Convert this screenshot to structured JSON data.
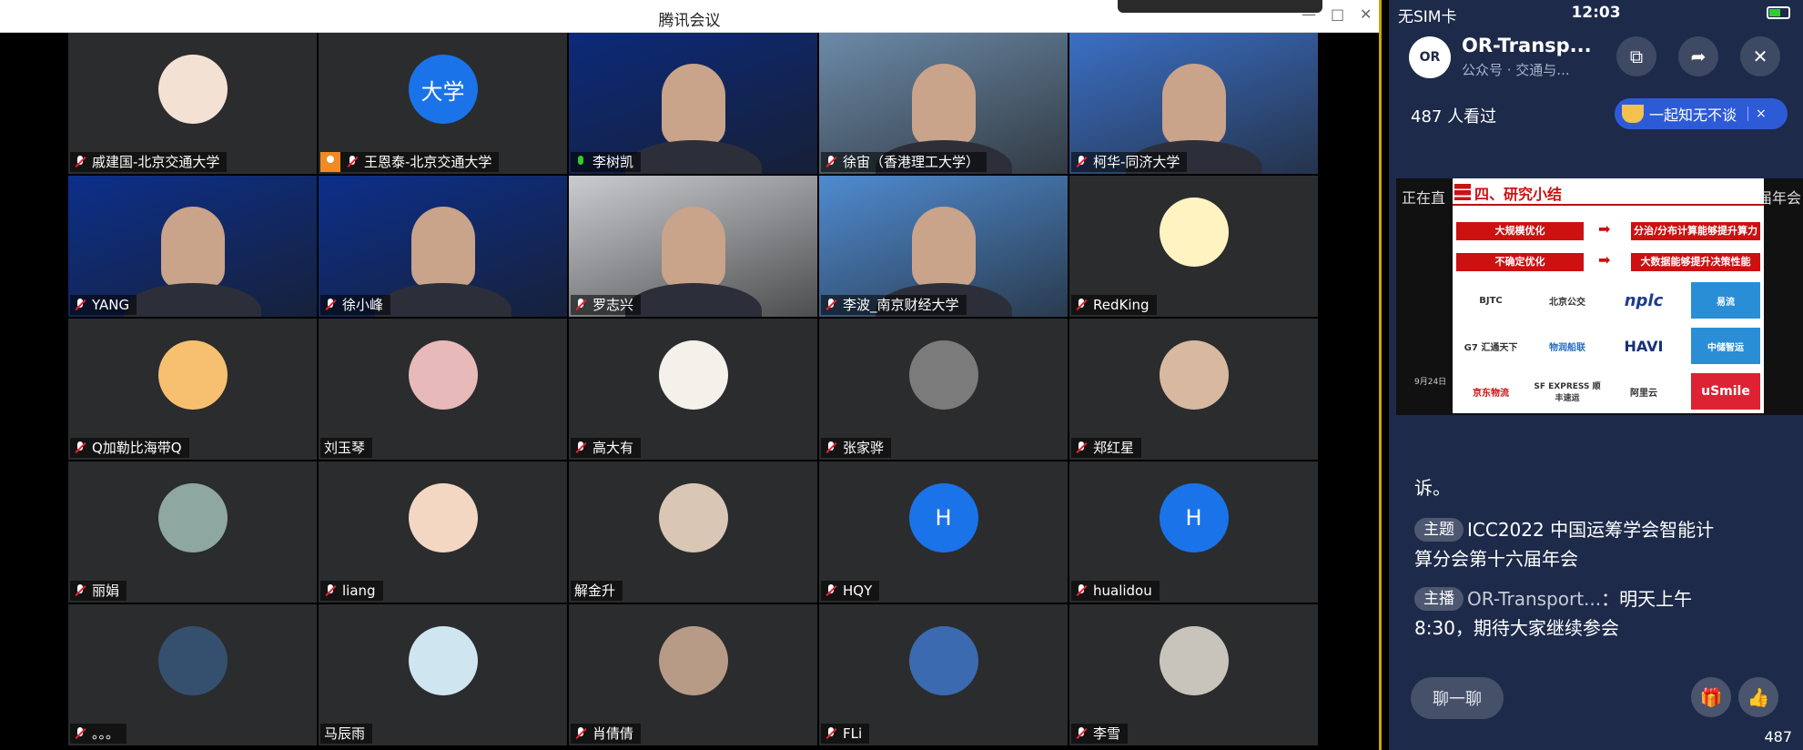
{
  "meeting": {
    "title": "腾讯会议",
    "participants": [
      {
        "name": "戚建国-北京交通大学",
        "kind": "avatar",
        "avatar_color": "#f3e2d4",
        "avatar_text": "",
        "mic": "muted"
      },
      {
        "name": "王恩泰-北京交通大学",
        "kind": "avatar",
        "avatar_color": "#1a73e8",
        "avatar_text": "大学",
        "mic": "muted",
        "host": true
      },
      {
        "name": "李树凯",
        "kind": "video",
        "bg": "#0c2a7a",
        "mic": "on",
        "talking": true
      },
      {
        "name": "徐宙（香港理工大学）",
        "kind": "video",
        "bg": "#6b8aa8",
        "mic": "muted"
      },
      {
        "name": "柯华-同济大学",
        "kind": "video",
        "bg": "#3b6fc4",
        "mic": "muted"
      },
      {
        "name": "YANG",
        "kind": "video",
        "bg": "#0c2f8a",
        "mic": "muted"
      },
      {
        "name": "徐小峰",
        "kind": "video",
        "bg": "#0c2f8a",
        "mic": "muted"
      },
      {
        "name": "罗志兴",
        "kind": "video",
        "bg": "#c9ccd0",
        "mic": "muted"
      },
      {
        "name": "李波_南京财经大学",
        "kind": "video",
        "bg": "#4f8bd0",
        "mic": "muted"
      },
      {
        "name": "RedKing",
        "kind": "avatar",
        "avatar_color": "#fff3c2",
        "avatar_text": "",
        "mic": "muted"
      },
      {
        "name": "Q加勒比海带Q",
        "kind": "avatar",
        "avatar_color": "#f6c070",
        "avatar_text": "",
        "mic": "muted"
      },
      {
        "name": "刘玉琴",
        "kind": "avatar",
        "avatar_color": "#e8b9b9",
        "avatar_text": "",
        "mic": "none"
      },
      {
        "name": "高大有",
        "kind": "avatar",
        "avatar_color": "#f4f1ea",
        "avatar_text": "",
        "mic": "muted"
      },
      {
        "name": "张家骅",
        "kind": "avatar",
        "avatar_color": "#7b7b7b",
        "avatar_text": "",
        "mic": "muted"
      },
      {
        "name": "郑红星",
        "kind": "avatar",
        "avatar_color": "#d8b9a0",
        "avatar_text": "",
        "mic": "muted"
      },
      {
        "name": "丽娟",
        "kind": "avatar",
        "avatar_color": "#8ea7a0",
        "avatar_text": "",
        "mic": "muted"
      },
      {
        "name": "liang",
        "kind": "avatar",
        "avatar_color": "#f4d7c2",
        "avatar_text": "",
        "mic": "muted"
      },
      {
        "name": "解金升",
        "kind": "avatar",
        "avatar_color": "#d9c6b5",
        "avatar_text": "",
        "mic": "none"
      },
      {
        "name": "HQY",
        "kind": "avatar",
        "avatar_color": "#1a73e8",
        "avatar_text": "H",
        "mic": "muted"
      },
      {
        "name": "hualidou",
        "kind": "avatar",
        "avatar_color": "#1a73e8",
        "avatar_text": "H",
        "mic": "muted"
      },
      {
        "name": "。。。",
        "kind": "avatar",
        "avatar_color": "#35506f",
        "avatar_text": "",
        "mic": "muted"
      },
      {
        "name": "马辰雨",
        "kind": "avatar",
        "avatar_color": "#cfe6f0",
        "avatar_text": "",
        "mic": "none"
      },
      {
        "name": "肖倩倩",
        "kind": "avatar",
        "avatar_color": "#b89b87",
        "avatar_text": "",
        "mic": "muted"
      },
      {
        "name": "FLi",
        "kind": "avatar",
        "avatar_color": "#3b6ab0",
        "avatar_text": "",
        "mic": "muted"
      },
      {
        "name": "李雪",
        "kind": "avatar",
        "avatar_color": "#c9c4bb",
        "avatar_text": "",
        "mic": "muted"
      }
    ]
  },
  "phone": {
    "carrier": "无SIM卡",
    "time": "12:03",
    "account_name": "OR-Transp...",
    "account_sub": "公众号 · 交通与...",
    "viewers": "487 人看过",
    "promo_text": "一起知无不谈",
    "promo_close": "×",
    "live_left": "正在直",
    "live_right": "届年会",
    "slide": {
      "title": "四、研究小结",
      "rows": [
        {
          "left": "大规模优化",
          "right": "分治/分布计算能够提升算力"
        },
        {
          "left": "不确定优化",
          "right": "大数据能够提升决策性能"
        }
      ],
      "logos": [
        "北京公交",
        "nplc",
        "易流",
        "G7 汇通天下",
        "物润船联",
        "HAVI",
        "中储智运",
        "京东物流",
        "SF EXPRESS 顺丰速运",
        "阿里云",
        "uSmile"
      ],
      "side_note": "9月24日"
    },
    "chat_prefix_text": "诉。",
    "msg1_tag": "主题",
    "msg1_text": "ICC2022 中国运筹学会智能计算分会第十六届年会",
    "msg2_tag": "主播",
    "msg2_author": "OR-Transport...",
    "msg2_text": "：明天上午8:30，期待大家继续参会",
    "chat_button": "聊一聊",
    "like_count": "487"
  },
  "colors": {
    "accent_blue": "#1a73e8",
    "talking_green": "#3fd36b",
    "phone_bg": "#1d2a49",
    "host_orange": "#f08a24"
  },
  "icons": [
    "mic-muted-icon",
    "mic-on-icon",
    "host-icon",
    "battery-icon",
    "share-icon",
    "close-icon",
    "gift-icon",
    "thumbs-up-icon",
    "floating-window-icon"
  ]
}
